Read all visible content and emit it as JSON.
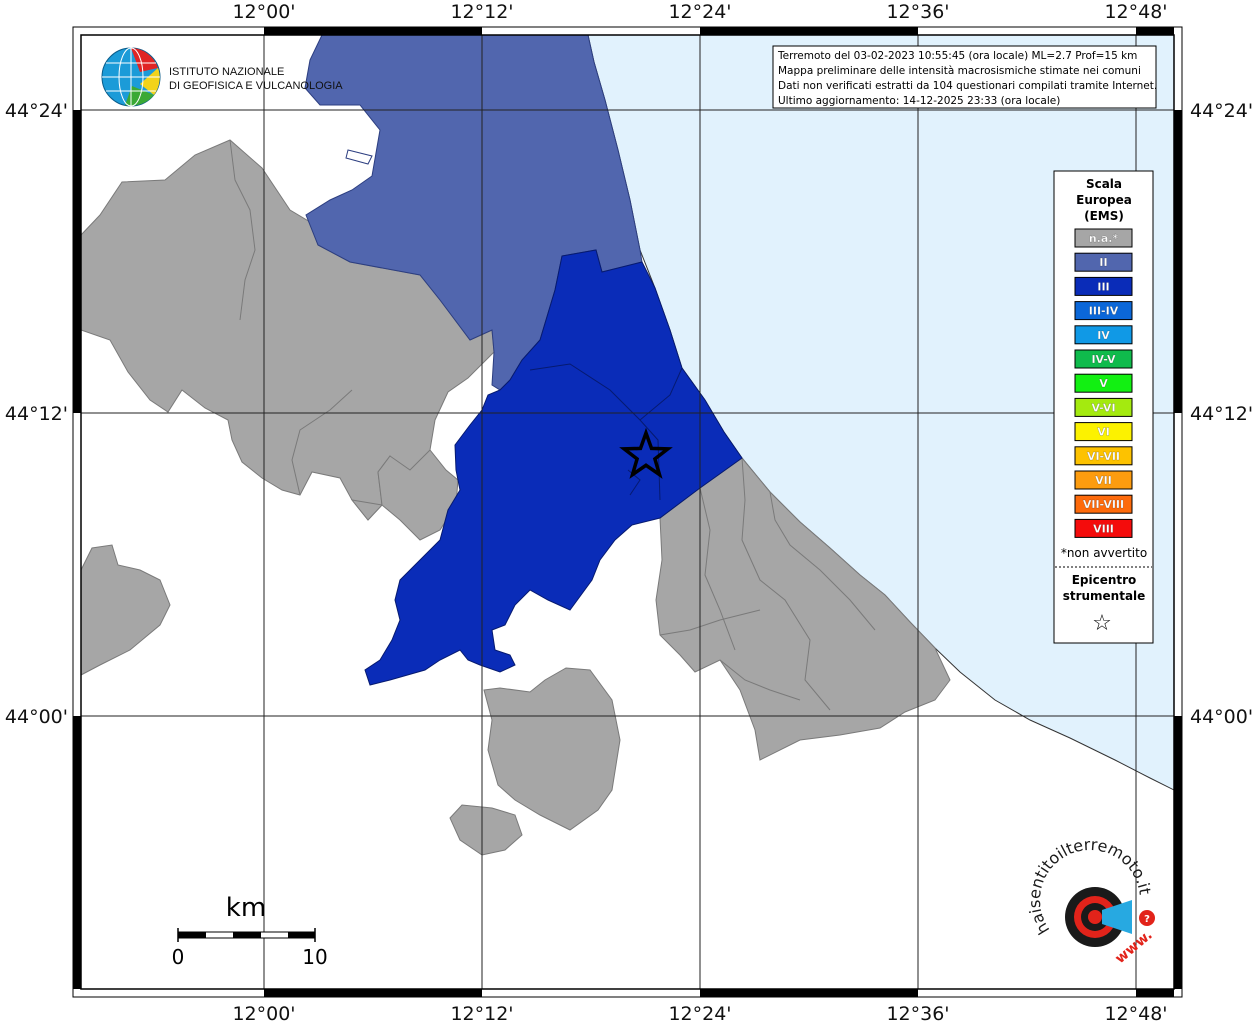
{
  "map": {
    "lon_ticks": [
      "12°00'",
      "12°12'",
      "12°24'",
      "12°36'",
      "12°48'"
    ],
    "lat_ticks": [
      "44°24'",
      "44°12'",
      "44°00'"
    ]
  },
  "logo": {
    "line1": "ISTITUTO NAZIONALE",
    "line2": "DI GEOFISICA E VULCANOLOGIA"
  },
  "info_box": {
    "line1": "Terremoto del 03-02-2023 10:55:45 (ora locale) ML=2.7 Prof=15 km",
    "line2": "Mappa preliminare delle intensità macrosismiche stimate nei comuni",
    "line3": "Dati non verificati estratti da 104 questionari compilati tramite Internet.",
    "line4": "Ultimo aggiornamento: 14-12-2025 23:33 (ora locale)"
  },
  "legend": {
    "title1": "Scala",
    "title2": "Europea",
    "title3": "(EMS)",
    "items": [
      {
        "label": "n.a.*",
        "color": "#a6a6a6"
      },
      {
        "label": "II",
        "color": "#5166ae"
      },
      {
        "label": "III",
        "color": "#0a2cb8"
      },
      {
        "label": "III-IV",
        "color": "#0b67d8"
      },
      {
        "label": "IV",
        "color": "#1099e6"
      },
      {
        "label": "IV-V",
        "color": "#0fbb4c"
      },
      {
        "label": "V",
        "color": "#12f012"
      },
      {
        "label": "V-VI",
        "color": "#a4ea0f"
      },
      {
        "label": "VI",
        "color": "#fcf200"
      },
      {
        "label": "VI-VII",
        "color": "#fdc200"
      },
      {
        "label": "VII",
        "color": "#fd9c0f"
      },
      {
        "label": "VII-VIII",
        "color": "#fd6a0b"
      },
      {
        "label": "VIII",
        "color": "#f40c0c"
      }
    ],
    "note": "*non avvertito",
    "epicenter1": "Epicentro",
    "epicenter2": "strumentale",
    "epicenter_symbol": "☆"
  },
  "scale_bar": {
    "unit": "km",
    "label_start": "0",
    "label_end": "10"
  },
  "hsit_logo": {
    "text": "haisentitoilterremoto.it",
    "prefix": "www."
  },
  "colors": {
    "sea": "#e1f2fd",
    "na": "#a6a6a6",
    "ems_ii": "#5166ae",
    "ems_iii": "#0a2cb8"
  }
}
